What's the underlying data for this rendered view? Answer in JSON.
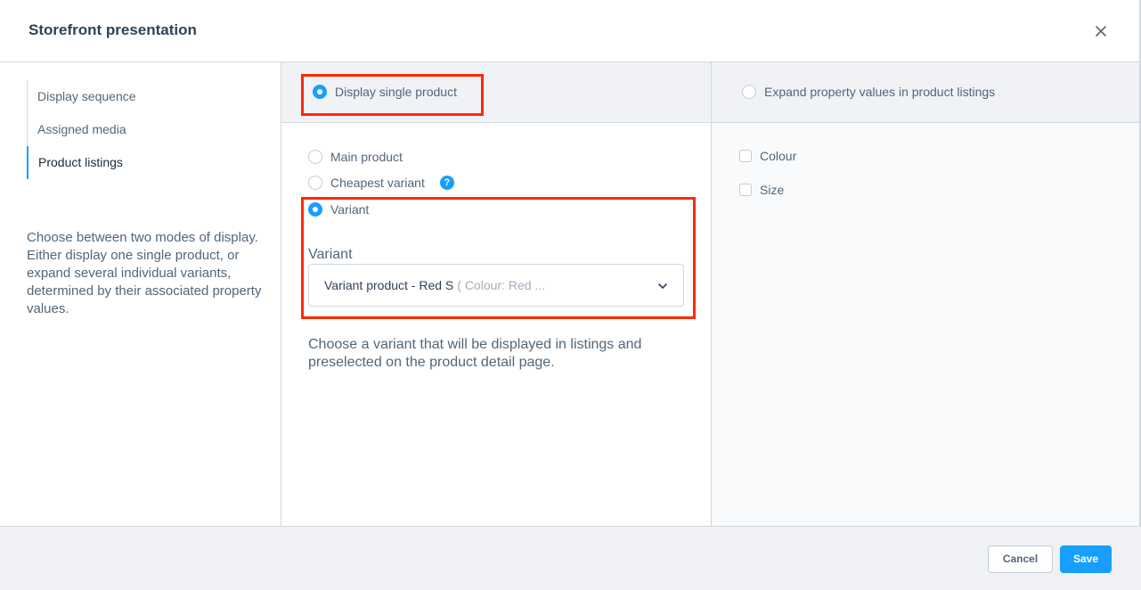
{
  "modal": {
    "title": "Storefront presentation",
    "close_icon": "close-icon"
  },
  "sidebar": {
    "items": [
      {
        "label": "Display sequence"
      },
      {
        "label": "Assigned media"
      },
      {
        "label": "Product listings"
      }
    ],
    "active_item": "Product listings",
    "description": "Choose between two modes of display. Either display one single product, or expand several individual variants, determined by their associated property values."
  },
  "mode_tabs": {
    "single": {
      "label": "Display single product",
      "selected": true
    },
    "expand": {
      "label": "Expand property values in product listings",
      "selected": false
    }
  },
  "single_options": {
    "main_product": {
      "label": "Main product",
      "selected": false
    },
    "cheapest_variant": {
      "label": "Cheapest variant",
      "selected": false,
      "help_icon": "?"
    },
    "variant": {
      "label": "Variant",
      "selected": true
    }
  },
  "variant_field": {
    "label": "Variant",
    "value": "Variant product - Red S",
    "value_detail": "( Colour: Red ...",
    "help_text": "Choose a variant that will be displayed in listings and preselected on the product detail page."
  },
  "properties": [
    {
      "label": "Colour",
      "checked": false
    },
    {
      "label": "Size",
      "checked": false
    }
  ],
  "footer": {
    "cancel_label": "Cancel",
    "save_label": "Save"
  },
  "colors": {
    "accent": "#189eff",
    "highlight": "#ff2a00",
    "border": "#d1d9e0",
    "panel": "#f0f2f5"
  }
}
